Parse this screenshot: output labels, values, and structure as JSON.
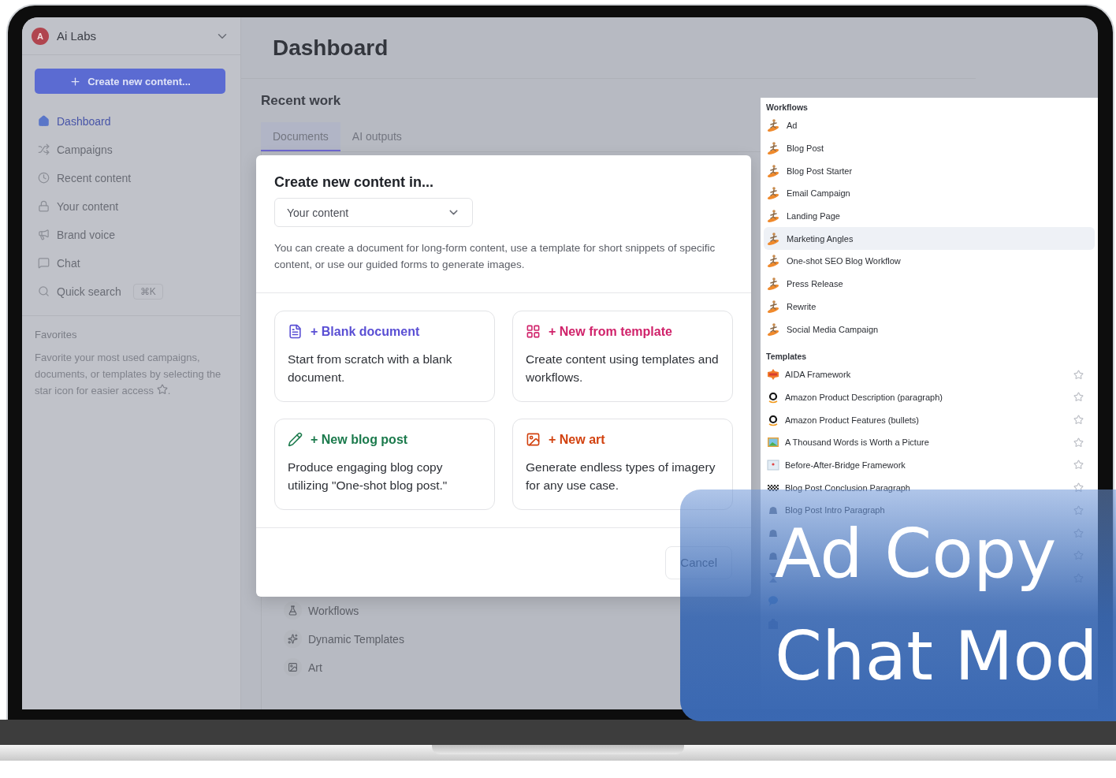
{
  "sidebar": {
    "workspace": {
      "initial": "A",
      "name": "Ai Labs"
    },
    "create_button": "Create new content...",
    "nav": [
      {
        "kind": "dashboard",
        "label": "Dashboard",
        "selected": true
      },
      {
        "kind": "campaigns",
        "label": "Campaigns",
        "selected": false
      },
      {
        "kind": "recent",
        "label": "Recent content",
        "selected": false
      },
      {
        "kind": "content",
        "label": "Your content",
        "selected": false
      },
      {
        "kind": "voice",
        "label": "Brand voice",
        "selected": false
      },
      {
        "kind": "chat",
        "label": "Chat",
        "selected": false
      },
      {
        "kind": "search",
        "label": "Quick search",
        "shortcut": "⌘K",
        "selected": false
      }
    ],
    "favorites": {
      "title": "Favorites",
      "text": "Favorite your most used campaigns, documents, or templates by selecting the star icon for easier access",
      "end": "."
    }
  },
  "header": {
    "title": "Dashboard"
  },
  "recent_work": {
    "title": "Recent work",
    "tabs": [
      {
        "label": "Documents",
        "selected": true
      },
      {
        "label": "AI outputs",
        "selected": false
      }
    ],
    "items": [
      {
        "kind": "workflow",
        "label": "Workflows"
      },
      {
        "kind": "dynamic",
        "label": "Dynamic Templates"
      },
      {
        "kind": "art",
        "label": "Art"
      }
    ]
  },
  "modal": {
    "title": "Create new content in...",
    "select": {
      "value": "Your content"
    },
    "description": "You can create a document for long-form content, use a template for short snippets of specific content, or use our guided forms to generate images.",
    "options": [
      {
        "kind": "document",
        "title": "+ Blank document",
        "text": "Start from scratch with a blank document.",
        "color": "#5a4fd4"
      },
      {
        "kind": "template",
        "title": "+ New from template",
        "text": "Create content using templates and workflows.",
        "color": "#d0226a"
      },
      {
        "kind": "blog",
        "title": "+ New blog post",
        "text": "Produce engaging blog copy utilizing \"One-shot blog post.\"",
        "color": "#1b7a4c"
      },
      {
        "kind": "art",
        "title": "+ New art",
        "text": "Generate endless types of imagery for any use case.",
        "color": "#d2420f"
      }
    ],
    "cancel": "Cancel"
  },
  "menu": {
    "sections": [
      {
        "title": "Workflows",
        "items": [
          {
            "kind": "surfer",
            "label": "Ad",
            "selected": false
          },
          {
            "kind": "surfer",
            "label": "Blog Post",
            "selected": false
          },
          {
            "kind": "surfer",
            "label": "Blog Post Starter",
            "selected": false
          },
          {
            "kind": "surfer",
            "label": "Email Campaign",
            "selected": false
          },
          {
            "kind": "surfer",
            "label": "Landing Page",
            "selected": false
          },
          {
            "kind": "surfer",
            "label": "Marketing Angles",
            "selected": true
          },
          {
            "kind": "surfer",
            "label": "One-shot SEO Blog Workflow",
            "selected": false
          },
          {
            "kind": "surfer",
            "label": "Press Release",
            "selected": false
          },
          {
            "kind": "surfer",
            "label": "Rewrite",
            "selected": false
          },
          {
            "kind": "surfer",
            "label": "Social Media Campaign",
            "selected": false
          }
        ]
      },
      {
        "title": "Templates",
        "items": [
          {
            "kind": "framework",
            "label": "AIDA Framework",
            "starred": false
          },
          {
            "kind": "amazon",
            "label": "Amazon Product Description (paragraph)",
            "starred": false
          },
          {
            "kind": "amazon",
            "label": "Amazon Product Features (bullets)",
            "starred": false
          },
          {
            "kind": "picture",
            "label": "A Thousand Words is Worth a Picture",
            "starred": false
          },
          {
            "kind": "calendar",
            "label": "Before-After-Bridge Framework",
            "starred": false
          },
          {
            "kind": "flag",
            "label": "Blog Post Conclusion Paragraph",
            "starred": false
          },
          {
            "kind": "stack",
            "label": "Blog Post Intro Paragraph",
            "starred": false
          },
          {
            "kind": "stack",
            "starred": false
          },
          {
            "kind": "stack",
            "starred": false
          },
          {
            "kind": "hourglass",
            "starred": false
          },
          {
            "kind": "speech"
          },
          {
            "kind": "building"
          }
        ]
      }
    ]
  },
  "banner": {
    "lines": [
      "Ad Copy",
      "Chat Mod"
    ]
  }
}
